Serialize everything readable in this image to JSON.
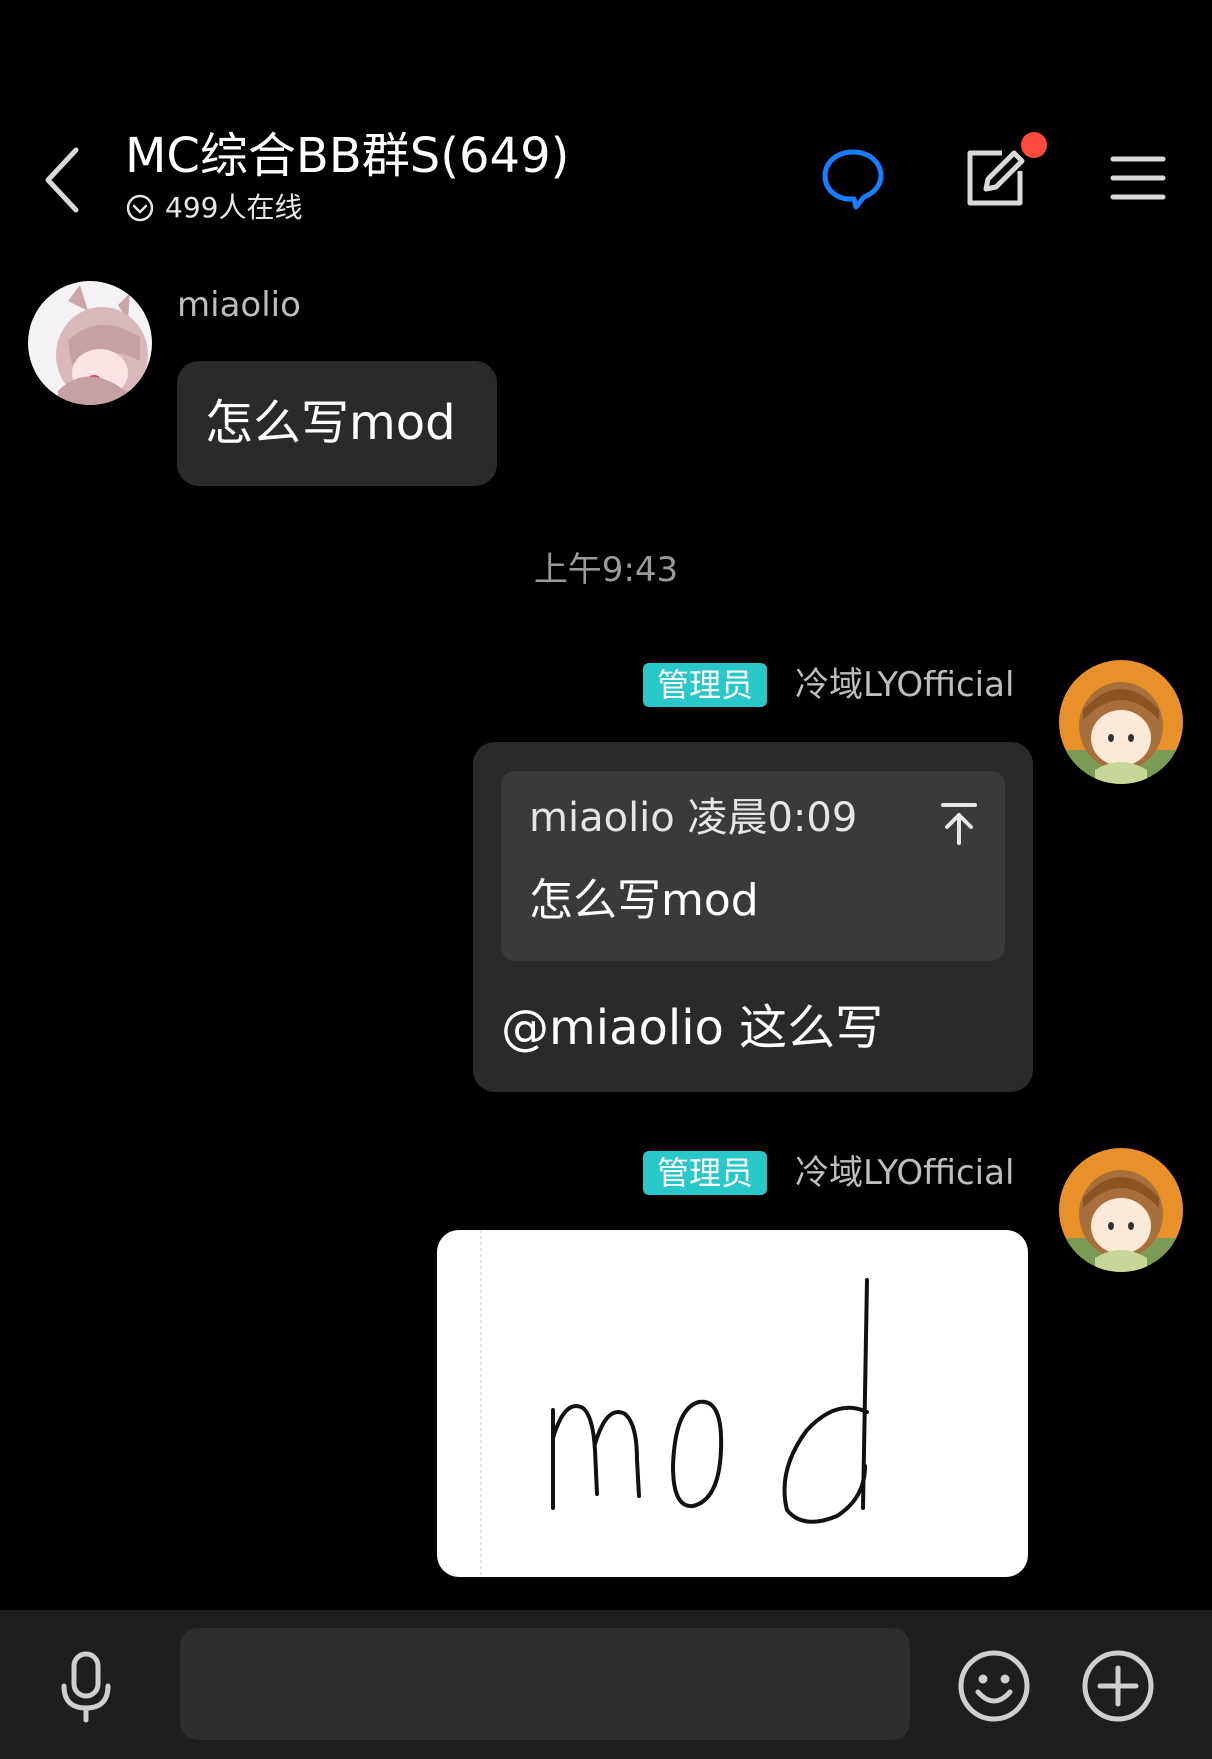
{
  "header": {
    "title": "MC综合BB群S(649)",
    "online_text": "499人在线",
    "has_notification_dot": true,
    "notification_color": "#ff4a3d",
    "chat_icon_color": "#1a7cff"
  },
  "messages": [
    {
      "sender": "miaolio",
      "side": "left",
      "text": "怎么写mod"
    },
    {
      "timestamp": "上午9:43"
    },
    {
      "sender": "冷域LYOfficial",
      "badge": "管理员",
      "side": "right",
      "quote": {
        "author_time": "miaolio 凌晨0:09",
        "text": "怎么写mod"
      },
      "text": "@miaolio 这么写"
    },
    {
      "sender": "冷域LYOfficial",
      "badge": "管理员",
      "side": "right",
      "image_text": "mod"
    }
  ],
  "input": {
    "value": "",
    "placeholder": ""
  },
  "colors": {
    "background": "#000000",
    "bubble": "#2a2a2a",
    "badge": "#29c7c7",
    "bottom_bar": "#1e1e1e"
  }
}
